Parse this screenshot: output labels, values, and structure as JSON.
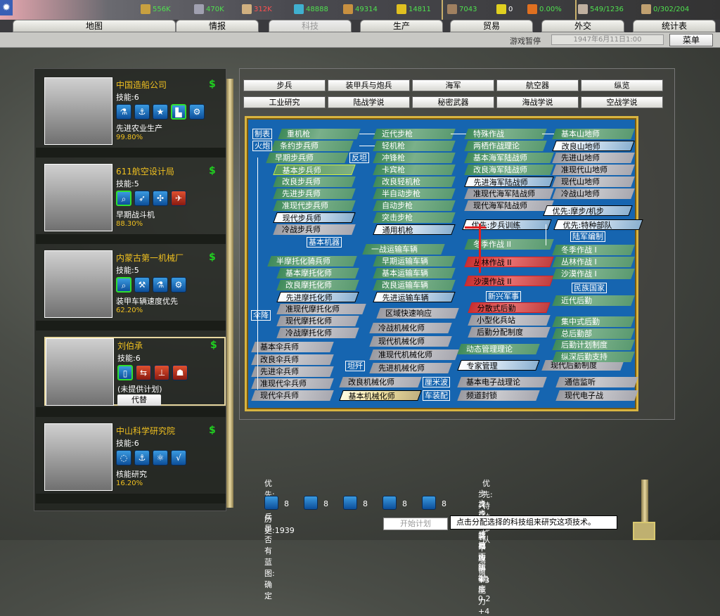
{
  "resources": [
    {
      "icon": "energy-icon",
      "value": "556K",
      "color": "#4fe04f"
    },
    {
      "icon": "metal-icon",
      "value": "470K",
      "color": "#4fe04f"
    },
    {
      "icon": "rare-materials-icon",
      "value": "312K",
      "color": "#ff5050"
    },
    {
      "icon": "oil-icon",
      "value": "48888",
      "color": "#4fe04f"
    },
    {
      "icon": "supplies-icon",
      "value": "49314",
      "color": "#4fe04f"
    },
    {
      "icon": "money-icon",
      "value": "14811",
      "color": "#4fe04f"
    },
    {
      "icon": "manpower-icon",
      "value": "7043",
      "color": "#4fe04f"
    },
    {
      "icon": "nuke-icon",
      "value": "0",
      "color": "#fff"
    },
    {
      "icon": "dissent-icon",
      "value": "0.00%",
      "color": "#4fe04f"
    },
    {
      "icon": "transport-icon",
      "value": "549/1236",
      "color": "#4fe04f"
    },
    {
      "icon": "convoy-icon",
      "value": "0/302/204",
      "color": "#4fe04f"
    }
  ],
  "tabs": [
    "地图",
    "情报",
    "科技",
    "生产",
    "贸易",
    "外交",
    "统计表"
  ],
  "subbar": {
    "pause": "游戏暂停",
    "date": "1947年6月11日1:00",
    "menu": "菜单"
  },
  "teams": [
    {
      "name": "中国造船公司",
      "skill": "技能:6",
      "icons": [
        "flask",
        "anchor",
        "star",
        "factory",
        "gears"
      ],
      "project": "先进农业生产",
      "pct": "99.80%"
    },
    {
      "name": "611航空设计局",
      "skill": "技能:5",
      "icons": [
        "telescope",
        "rocket",
        "propeller",
        "plane"
      ],
      "project": "早期战斗机",
      "pct": "88.30%"
    },
    {
      "name": "内蒙古第一机械厂",
      "skill": "技能:5",
      "icons": [
        "telescope",
        "wrench",
        "flask",
        "gears"
      ],
      "project": "装甲车辆速度优先",
      "pct": "62.20%"
    },
    {
      "name": "刘伯承",
      "skill": "技能:6",
      "icons": [
        "book",
        "tactics",
        "org-chart",
        "soldier"
      ],
      "project": "(未提供计划)",
      "pct": "",
      "replace": "代替"
    },
    {
      "name": "中山科学研究院",
      "skill": "技能:6",
      "icons": [
        "bulb",
        "anchor",
        "atom",
        "math"
      ],
      "project": "核能研究",
      "pct": "16.20%"
    }
  ],
  "categories": [
    "步兵",
    "装甲兵与炮兵",
    "海军",
    "航空器",
    "纵览",
    "工业研究",
    "陆战学说",
    "秘密武器",
    "海战学说",
    "空战学说"
  ],
  "tree": {
    "nodes": [
      [
        "重机枪",
        "g"
      ],
      [
        "条约步兵师",
        "g"
      ],
      [
        "早期步兵师",
        "g"
      ],
      [
        "基本步兵师",
        "h"
      ],
      [
        "改良步兵师",
        "g"
      ],
      [
        "先进步兵师",
        "g"
      ],
      [
        "准现代步兵师",
        "g"
      ],
      [
        "现代步兵师",
        "a"
      ],
      [
        "冷战步兵师",
        "x"
      ],
      [
        "近代步枪",
        "g"
      ],
      [
        "轻机枪",
        "g"
      ],
      [
        "冲锋枪",
        "g"
      ],
      [
        "卡宾枪",
        "g"
      ],
      [
        "改良轻机枪",
        "g"
      ],
      [
        "半自动步枪",
        "g"
      ],
      [
        "自动步枪",
        "g"
      ],
      [
        "突击步枪",
        "g"
      ],
      [
        "通用机枪",
        "a"
      ],
      [
        "特殊作战",
        "g"
      ],
      [
        "两栖作战理论",
        "g"
      ],
      [
        "基本海军陆战师",
        "g"
      ],
      [
        "改良海军陆战师",
        "g"
      ],
      [
        "先进海军陆战师",
        "a"
      ],
      [
        "准现代海军陆战师",
        "x"
      ],
      [
        "现代海军陆战师",
        "x"
      ],
      [
        "基本山地师",
        "g"
      ],
      [
        "改良山地师",
        "a"
      ],
      [
        "先进山地师",
        "x"
      ],
      [
        "准现代山地师",
        "x"
      ],
      [
        "现代山地师",
        "x"
      ],
      [
        "冷战山地师",
        "x"
      ],
      [
        "优先:摩步/机步",
        "a"
      ],
      [
        "优先:步兵训练",
        "a"
      ],
      [
        "优先:特种部队",
        "a"
      ],
      [
        "一战运输车辆",
        "g"
      ],
      [
        "冬季作战 II",
        "g"
      ],
      [
        "冬季作战 I",
        "g"
      ],
      [
        "丛林作战 II",
        "r"
      ],
      [
        "丛林作战 I",
        "g"
      ],
      [
        "沙漠作战 II",
        "r"
      ],
      [
        "沙漠作战 I",
        "g"
      ],
      [
        "半摩托化骑兵师",
        "g"
      ],
      [
        "基本摩托化师",
        "g"
      ],
      [
        "改良摩托化师",
        "g"
      ],
      [
        "先进摩托化师",
        "a"
      ],
      [
        "准现代摩托化师",
        "x"
      ],
      [
        "现代摩托化师",
        "x"
      ],
      [
        "冷战摩托化师",
        "x"
      ],
      [
        "早期运输车辆",
        "g"
      ],
      [
        "基本运输车辆",
        "g"
      ],
      [
        "改良运输车辆",
        "g"
      ],
      [
        "先进运输车辆",
        "a"
      ],
      [
        "区域快速响应",
        "x"
      ],
      [
        "冷战机械化师",
        "x"
      ],
      [
        "现代机械化师",
        "x"
      ],
      [
        "准现代机械化师",
        "x"
      ],
      [
        "先进机械化师",
        "x"
      ],
      [
        "改良机械化师",
        "x"
      ],
      [
        "基本机械化师",
        "y"
      ],
      [
        "基本伞兵师",
        "x"
      ],
      [
        "改良伞兵师",
        "x"
      ],
      [
        "先进伞兵师",
        "x"
      ],
      [
        "准现代伞兵师",
        "x"
      ],
      [
        "现代伞兵师",
        "x"
      ],
      [
        "分散式后勤",
        "r"
      ],
      [
        "小型化兵站",
        "x"
      ],
      [
        "后勤分配制度",
        "x"
      ],
      [
        "动态管理理论",
        "g"
      ],
      [
        "专家管理",
        "a"
      ],
      [
        "现代后勤制度",
        "x"
      ],
      [
        "近代后勤",
        "g"
      ],
      [
        "集中式后勤",
        "g"
      ],
      [
        "总后勤部",
        "g"
      ],
      [
        "后勤计划制度",
        "g"
      ],
      [
        "纵深后勤支持",
        "g"
      ],
      [
        "基本电子战理论",
        "x"
      ],
      [
        "频道封锁",
        "x"
      ],
      [
        "通信监听",
        "x"
      ],
      [
        "现代电子战",
        "x"
      ]
    ],
    "labels": [
      "制表",
      "火炮",
      "反坦",
      "基本机器",
      "伞降",
      "坦歼",
      "厘米波",
      "车装配",
      "陆军编制",
      "民族国家",
      "新兴军事"
    ]
  },
  "bottom": {
    "priority_left": "优先:步兵",
    "costs": [
      {
        "icon": "book",
        "value": "8"
      },
      {
        "icon": "book",
        "value": "8"
      },
      {
        "icon": "telescope",
        "value": "8"
      },
      {
        "icon": "factory",
        "value": "8"
      },
      {
        "icon": "book",
        "value": "8"
      }
    ],
    "history": "历史:1939",
    "blueprint": "是否有蓝图: 确定",
    "priority_right": "优先:特种部队",
    "effects": [
      "步兵  :  非装甲攻击   +3",
      "步兵  :  装甲攻击   +1",
      "步兵  :  地面防御能力   +4",
      "步兵  :  组织度   0.2"
    ],
    "start": "开始计划",
    "tooltip": "点击分配选择的科技组来研究这项技术。"
  }
}
